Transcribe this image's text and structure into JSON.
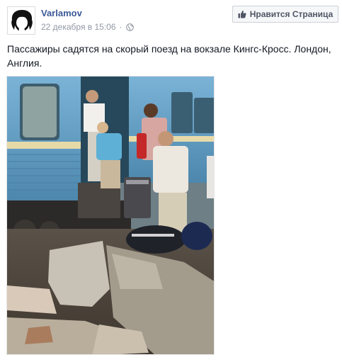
{
  "post": {
    "page_name": "Varlamov",
    "timestamp": "22 декабря в 15:06",
    "separator": "·",
    "privacy_icon": "globe-icon",
    "like_button": {
      "label": "Нравится Страница",
      "icon": "thumbs-up-icon"
    },
    "caption": "Пассажиры садятся на скорый поезд на вокзале Кингс-Кросс. Лондон, Англия.",
    "photo": {
      "subject": "people-boarding-train-photo"
    }
  },
  "colors": {
    "link": "#3b5998",
    "meta": "#9197a3",
    "train": "#5a9bc4"
  }
}
